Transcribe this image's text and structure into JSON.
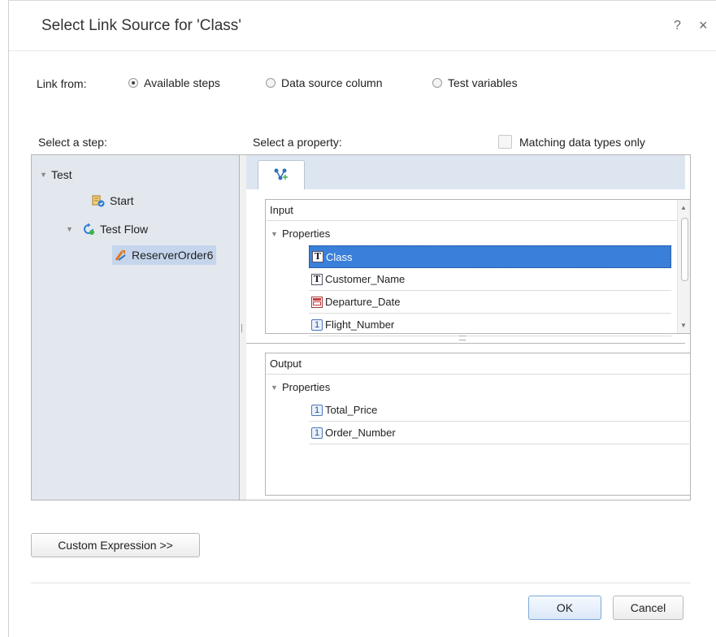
{
  "dialog": {
    "title": "Select Link Source for 'Class'",
    "help": "?",
    "close": "×"
  },
  "link_from": {
    "label": "Link from:",
    "options": [
      {
        "label": "Available steps",
        "checked": true
      },
      {
        "label": "Data source column",
        "checked": false
      },
      {
        "label": "Test variables",
        "checked": false
      }
    ]
  },
  "step_section": {
    "label": "Select a step:",
    "tree": [
      {
        "label": "Test",
        "icon": "caret-down-icon"
      },
      {
        "label": "Start",
        "icon": "start-step-icon"
      },
      {
        "label": "Test Flow",
        "icon": "flow-loop-icon"
      },
      {
        "label": "ReserverOrder6",
        "icon": "wrench-activity-icon",
        "selected": true
      }
    ]
  },
  "property_section": {
    "label": "Select a property:",
    "matching_label": "Matching data types only",
    "matching_checked": false,
    "tab_icon": "data-link-icon",
    "input": {
      "header": "Input",
      "group": "Properties",
      "rows": [
        {
          "name": "Class",
          "type": "T",
          "selected": true
        },
        {
          "name": "Customer_Name",
          "type": "T"
        },
        {
          "name": "Departure_Date",
          "type": "date"
        },
        {
          "name": "Flight_Number",
          "type": "1"
        }
      ]
    },
    "output": {
      "header": "Output",
      "group": "Properties",
      "rows": [
        {
          "name": "Total_Price",
          "type": "1"
        },
        {
          "name": "Order_Number",
          "type": "1"
        }
      ]
    }
  },
  "buttons": {
    "custom_expression": "Custom Expression >>",
    "ok": "OK",
    "cancel": "Cancel"
  }
}
